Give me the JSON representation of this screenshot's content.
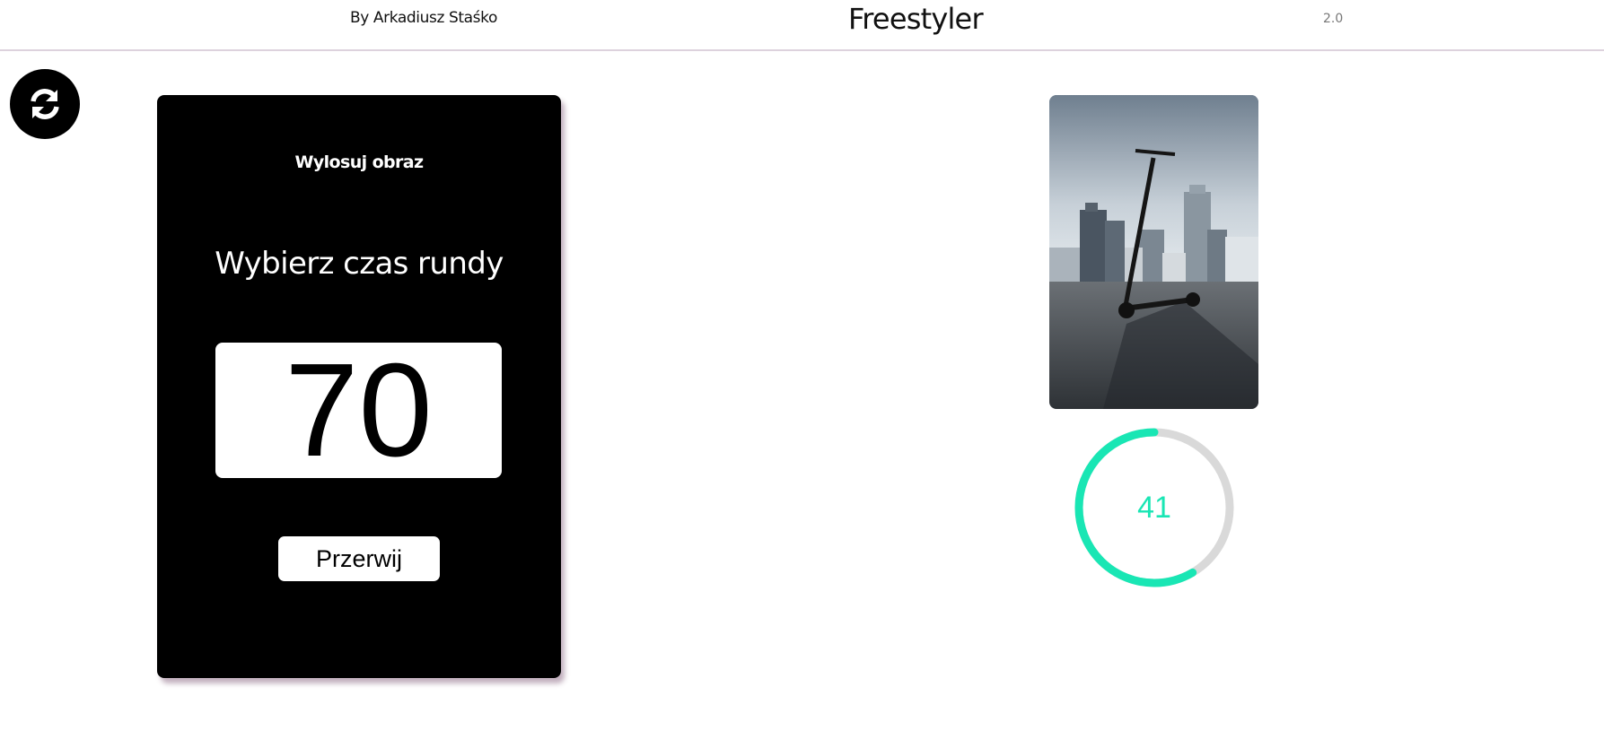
{
  "header": {
    "author": "By Arkadiusz Staśko",
    "title": "Freestyler",
    "version": "2.0"
  },
  "refresh_button": {
    "icon": "refresh-icon"
  },
  "round_card": {
    "draw_label": "Wylosuj obraz",
    "heading": "Wybierz czas rundy",
    "selected_time": "70",
    "stop_label": "Przerwij"
  },
  "image_panel": {
    "subject": "electric-scooter-photo"
  },
  "timer": {
    "value": "41",
    "progress_fraction": 0.585,
    "progress_color": "#19e6b4",
    "track_color": "#d9d9d9"
  },
  "colors": {
    "card_background": "#000000",
    "accent": "#19e6b4"
  }
}
